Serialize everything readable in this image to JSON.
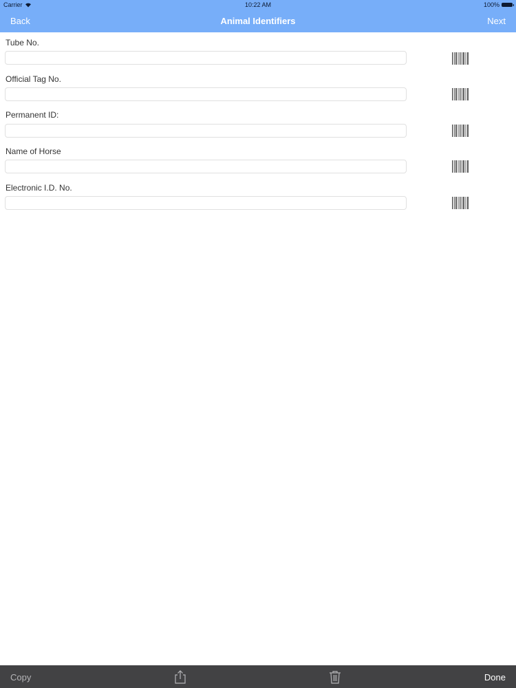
{
  "status_bar": {
    "carrier": "Carrier",
    "time": "10:22 AM",
    "battery": "100%"
  },
  "nav": {
    "back_label": "Back",
    "title": "Animal Identifiers",
    "next_label": "Next"
  },
  "fields": [
    {
      "label": "Tube No.",
      "value": ""
    },
    {
      "label": "Official Tag No.",
      "value": ""
    },
    {
      "label": "Permanent ID:",
      "value": ""
    },
    {
      "label": "Name of Horse",
      "value": ""
    },
    {
      "label": "Electronic I.D. No.",
      "value": ""
    }
  ],
  "toolbar": {
    "copy_label": "Copy",
    "done_label": "Done",
    "share_icon": "share-icon",
    "trash_icon": "trash-icon"
  },
  "colors": {
    "nav_bar": "#77aef9",
    "toolbar": "#424244"
  }
}
